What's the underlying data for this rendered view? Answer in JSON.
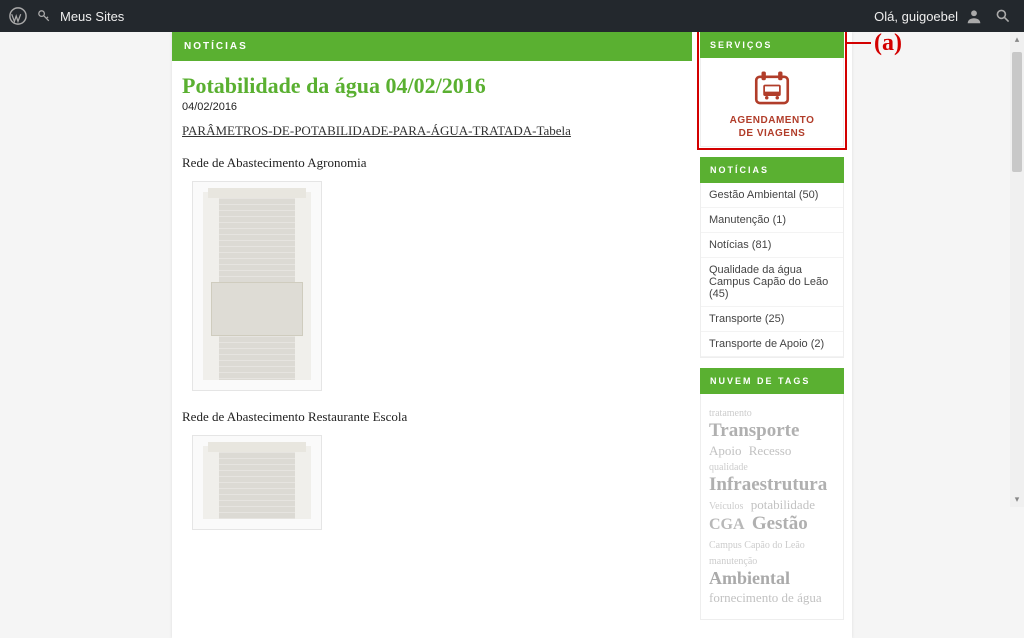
{
  "admin_bar": {
    "site_link": "Meus Sites",
    "greeting": "Olá, guigoebel"
  },
  "main": {
    "section_title": "NOTÍCIAS",
    "article_title": "Potabilidade da água 04/02/2016",
    "article_date": "04/02/2016",
    "param_link": "PARÂMETROS-DE-POTABILIDADE-PARA-ÁGUA-TRATADA-Tabela",
    "sub1": "Rede de Abastecimento Agronomia",
    "sub2": "Rede de Abastecimento Restaurante Escola"
  },
  "sidebar": {
    "servicos": {
      "title": "SERVIÇOS",
      "label_line1": "AGENDAMENTO",
      "label_line2": "DE VIAGENS"
    },
    "noticias": {
      "title": "NOTÍCIAS",
      "items": [
        "Gestão Ambiental (50)",
        "Manutenção (1)",
        "Notícias (81)",
        "Qualidade da água Campus Capão do Leão (45)",
        "Transporte (25)",
        "Transporte de Apoio (2)"
      ]
    },
    "tags": {
      "title": "NUVEM DE TAGS",
      "cloud": [
        {
          "text": "tratamento",
          "size": "t-xs"
        },
        {
          "text": "Transporte",
          "size": "t-lg"
        },
        {
          "text": "Apoio",
          "size": "t-sm"
        },
        {
          "text": "Recesso",
          "size": "t-sm"
        },
        {
          "text": "qualidade",
          "size": "t-xs"
        },
        {
          "text": "Infraestrutura",
          "size": "t-lg"
        },
        {
          "text": "Veículos",
          "size": "t-xs"
        },
        {
          "text": "potabilidade",
          "size": "t-sm"
        },
        {
          "text": "CGA",
          "size": "t-md"
        },
        {
          "text": "Gestão",
          "size": "t-lg"
        },
        {
          "text": "Campus Capão do Leão",
          "size": "t-xs"
        },
        {
          "text": "manutenção",
          "size": "t-xs"
        },
        {
          "text": "Ambiental",
          "size": "t-xl"
        },
        {
          "text": "fornecimento de água",
          "size": "t-sm"
        }
      ]
    }
  },
  "annotation": {
    "label": "(a)"
  }
}
